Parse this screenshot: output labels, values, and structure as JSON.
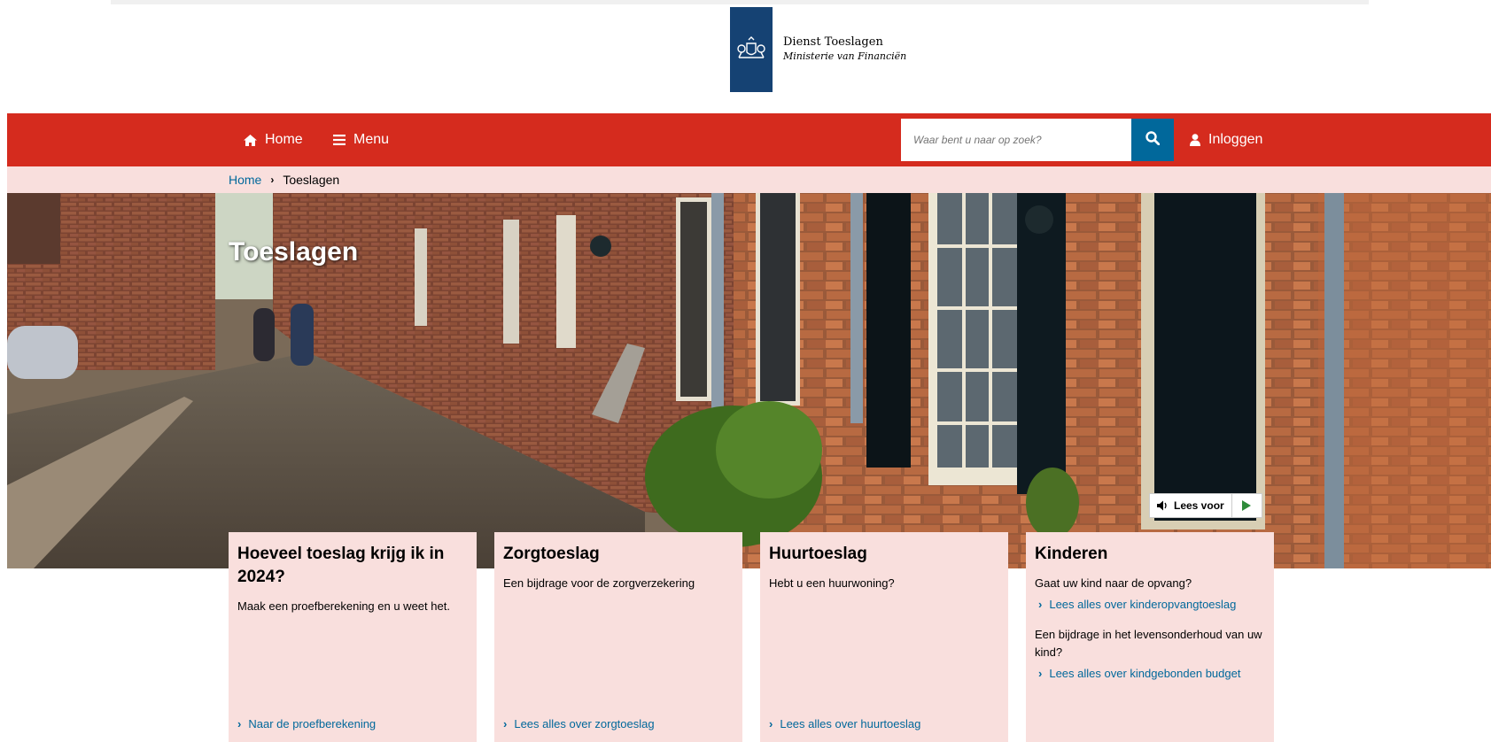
{
  "logo": {
    "title": "Dienst Toeslagen",
    "subtitle": "Ministerie van Financiën"
  },
  "nav": {
    "home_label": "Home",
    "menu_label": "Menu",
    "search_placeholder": "Waar bent u naar op zoek?",
    "login_label": "Inloggen"
  },
  "breadcrumb": {
    "home": "Home",
    "separator": "›",
    "current": "Toeslagen"
  },
  "hero": {
    "title": "Toeslagen",
    "read_aloud_label": "Lees voor"
  },
  "cards": [
    {
      "title": "Hoeveel toeslag krijg ik in 2024?",
      "text": "Maak een proefberekening en u weet het.",
      "link": "Naar de proefberekening"
    },
    {
      "title": "Zorgtoeslag",
      "text": "Een bijdrage voor de zorgverzekering",
      "link": "Lees alles over zorgtoeslag"
    },
    {
      "title": "Huurtoeslag",
      "text": "Hebt u een huurwoning?",
      "link": "Lees alles over huurtoeslag"
    },
    {
      "title": "Kinderen",
      "text": "Gaat uw kind naar de opvang?",
      "link": "Lees alles over kinderopvangtoeslag",
      "text2": "Een bijdrage in het levensonderhoud van uw kind?",
      "link2": "Lees alles over kindgebonden budget"
    }
  ],
  "colors": {
    "brand_red": "#d52b1e",
    "logo_blue": "#154273",
    "link_blue": "#01689b",
    "card_pink": "#f9dfdd"
  }
}
